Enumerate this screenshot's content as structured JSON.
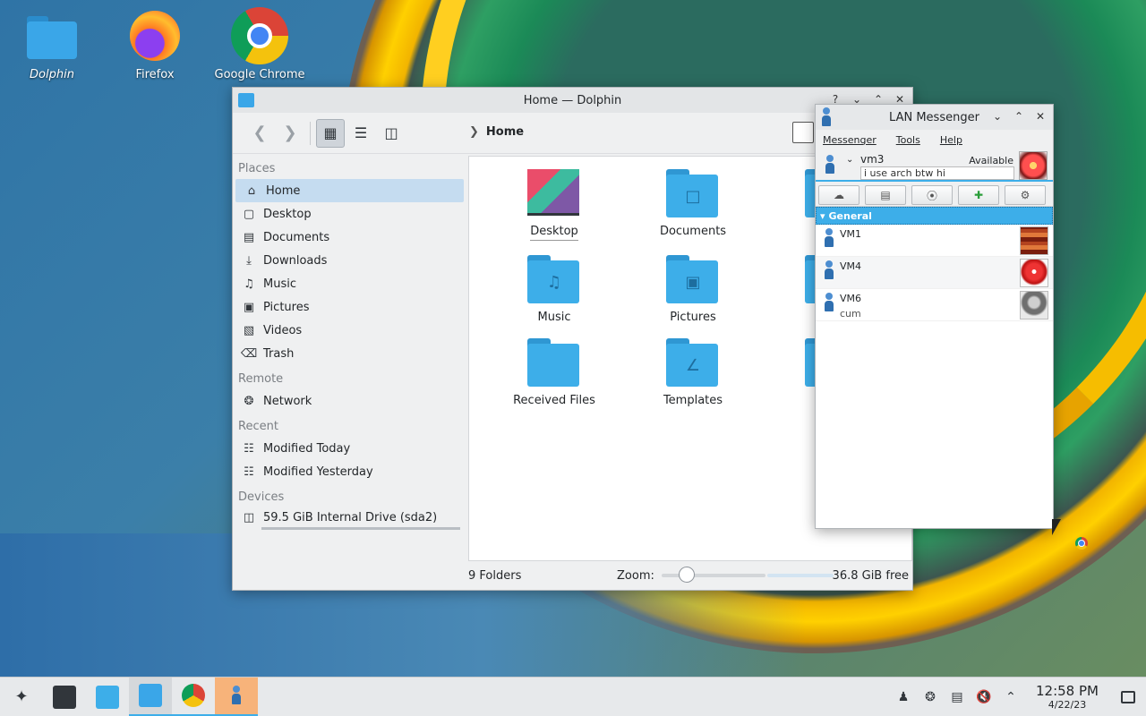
{
  "desktop": {
    "icons": [
      {
        "label": "Dolphin"
      },
      {
        "label": "Firefox"
      },
      {
        "label": "Google Chrome"
      }
    ]
  },
  "dolphin": {
    "title": "Home — Dolphin",
    "breadcrumb": "Home",
    "places": {
      "places_header": "Places",
      "items": [
        "Home",
        "Desktop",
        "Documents",
        "Downloads",
        "Music",
        "Pictures",
        "Videos",
        "Trash"
      ],
      "remote_header": "Remote",
      "remote_items": [
        "Network"
      ],
      "recent_header": "Recent",
      "recent_items": [
        "Modified Today",
        "Modified Yesterday"
      ],
      "devices_header": "Devices",
      "device_items": [
        "59.5 GiB Internal Drive (sda2)"
      ]
    },
    "files": [
      "Desktop",
      "Documents",
      "Dow",
      "Music",
      "Pictures",
      "P",
      "Received Files",
      "Templates",
      "V"
    ],
    "status": {
      "count": "9 Folders",
      "zoom_label": "Zoom:",
      "zoom_level": 0.2,
      "free_space": "36.8 GiB free"
    }
  },
  "lan_messenger": {
    "title": "LAN Messenger",
    "menu": [
      "Messenger",
      "Tools",
      "Help"
    ],
    "user": {
      "name": "vm3",
      "status": "Available",
      "note": "i use arch btw hi"
    },
    "group": "General",
    "contacts": [
      {
        "name": "VM1",
        "message": ""
      },
      {
        "name": "VM4",
        "message": ""
      },
      {
        "name": "VM6",
        "message": "cum"
      }
    ]
  },
  "taskbar": {
    "time": "12:58 PM",
    "date": "4/22/23"
  }
}
